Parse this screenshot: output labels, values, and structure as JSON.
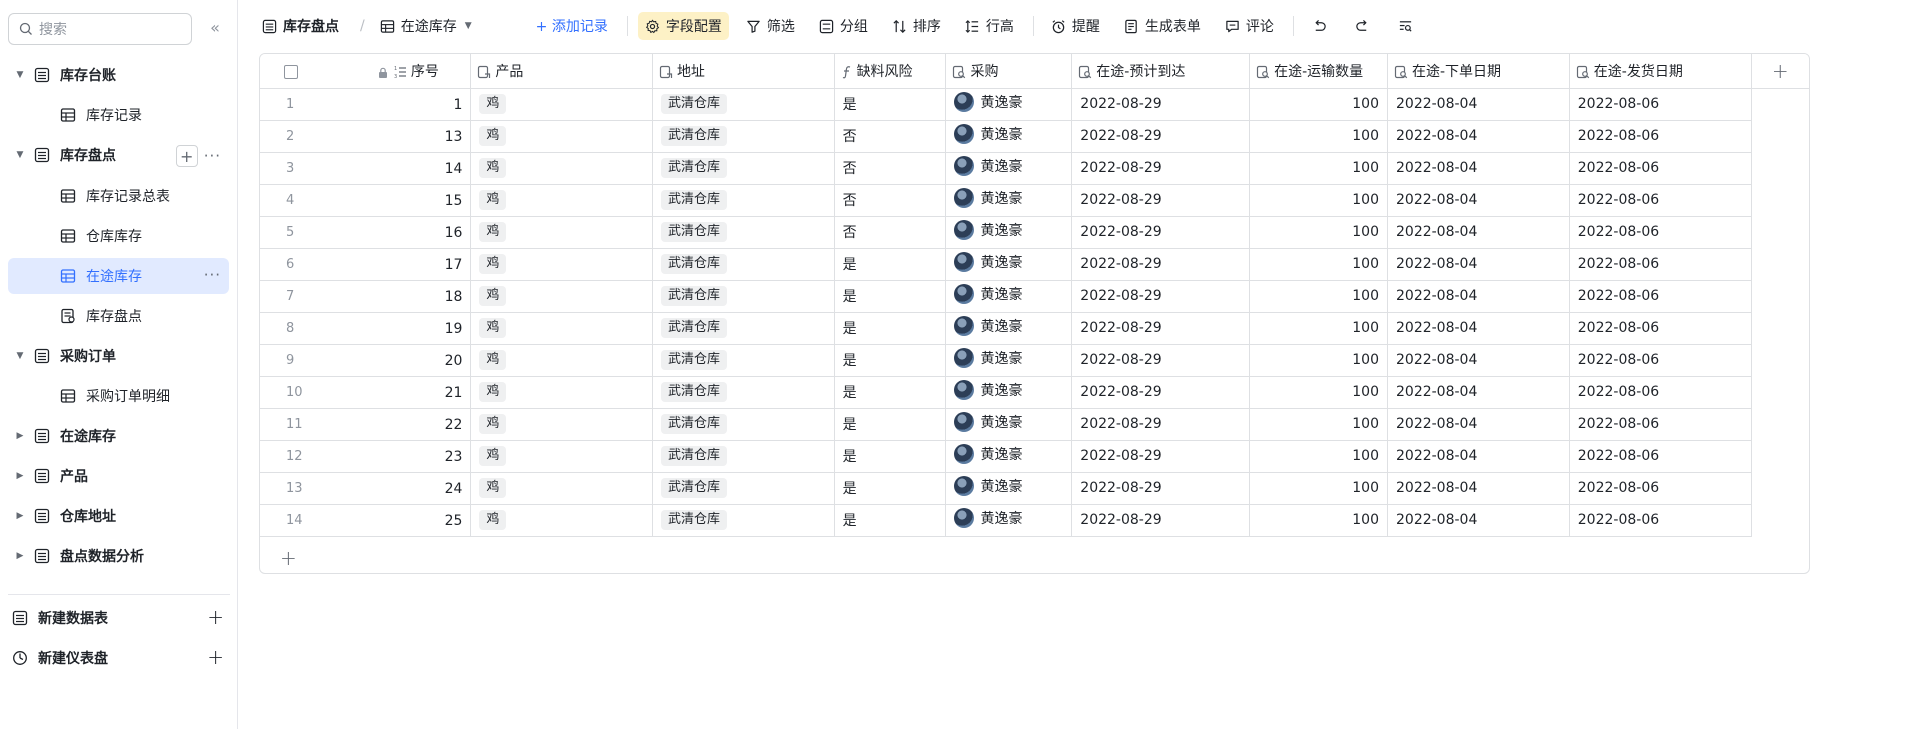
{
  "sidebar": {
    "search_placeholder": "搜索",
    "collapse_icon": "«",
    "items": [
      {
        "label": "库存台账",
        "level": "top",
        "icon": "table-icon",
        "expanded": true
      },
      {
        "label": "库存记录",
        "level": "child",
        "icon": "grid-icon"
      },
      {
        "label": "库存盘点",
        "level": "top",
        "icon": "table-icon",
        "expanded": true
      },
      {
        "label": "库存记录总表",
        "level": "child",
        "icon": "grid-icon"
      },
      {
        "label": "仓库库存",
        "level": "child",
        "icon": "grid-icon"
      },
      {
        "label": "在途库存",
        "level": "child",
        "icon": "grid-icon",
        "active": true
      },
      {
        "label": "库存盘点",
        "level": "child",
        "icon": "form-icon"
      },
      {
        "label": "采购订单",
        "level": "top",
        "icon": "table-icon",
        "expanded": true
      },
      {
        "label": "采购订单明细",
        "level": "child",
        "icon": "grid-icon"
      },
      {
        "label": "在途库存",
        "level": "top",
        "icon": "table-icon",
        "expanded": false
      },
      {
        "label": "产品",
        "level": "top",
        "icon": "table-icon",
        "expanded": false
      },
      {
        "label": "仓库地址",
        "level": "top",
        "icon": "table-icon",
        "expanded": false
      },
      {
        "label": "盘点数据分析",
        "level": "top",
        "icon": "table-icon",
        "expanded": false
      }
    ],
    "new_table": "新建数据表",
    "new_dashboard": "新建仪表盘"
  },
  "toolbar": {
    "table_title": "库存盘点",
    "separator": "/",
    "view_name": "在途库存",
    "add_record": "+ 添加记录",
    "field_config": "字段配置",
    "filter": "筛选",
    "group": "分组",
    "sort": "排序",
    "row_height": "行高",
    "reminder": "提醒",
    "generate_form": "生成表单",
    "comment": "评论"
  },
  "table": {
    "columns": [
      "序号",
      "产品",
      "地址",
      "缺料风险",
      "采购",
      "在途-预计到达",
      "在途-运输数量",
      "在途-下单日期",
      "在途-发货日期"
    ],
    "rows": [
      {
        "idx": "1",
        "seq": "1",
        "product": "鸡",
        "address": "武清仓库",
        "risk": "是",
        "buyer": "黄逸豪",
        "eta": "2022-08-29",
        "qty": "100",
        "order_date": "2022-08-04",
        "ship_date": "2022-08-06"
      },
      {
        "idx": "2",
        "seq": "13",
        "product": "鸡",
        "address": "武清仓库",
        "risk": "否",
        "buyer": "黄逸豪",
        "eta": "2022-08-29",
        "qty": "100",
        "order_date": "2022-08-04",
        "ship_date": "2022-08-06"
      },
      {
        "idx": "3",
        "seq": "14",
        "product": "鸡",
        "address": "武清仓库",
        "risk": "否",
        "buyer": "黄逸豪",
        "eta": "2022-08-29",
        "qty": "100",
        "order_date": "2022-08-04",
        "ship_date": "2022-08-06"
      },
      {
        "idx": "4",
        "seq": "15",
        "product": "鸡",
        "address": "武清仓库",
        "risk": "否",
        "buyer": "黄逸豪",
        "eta": "2022-08-29",
        "qty": "100",
        "order_date": "2022-08-04",
        "ship_date": "2022-08-06"
      },
      {
        "idx": "5",
        "seq": "16",
        "product": "鸡",
        "address": "武清仓库",
        "risk": "否",
        "buyer": "黄逸豪",
        "eta": "2022-08-29",
        "qty": "100",
        "order_date": "2022-08-04",
        "ship_date": "2022-08-06"
      },
      {
        "idx": "6",
        "seq": "17",
        "product": "鸡",
        "address": "武清仓库",
        "risk": "是",
        "buyer": "黄逸豪",
        "eta": "2022-08-29",
        "qty": "100",
        "order_date": "2022-08-04",
        "ship_date": "2022-08-06"
      },
      {
        "idx": "7",
        "seq": "18",
        "product": "鸡",
        "address": "武清仓库",
        "risk": "是",
        "buyer": "黄逸豪",
        "eta": "2022-08-29",
        "qty": "100",
        "order_date": "2022-08-04",
        "ship_date": "2022-08-06"
      },
      {
        "idx": "8",
        "seq": "19",
        "product": "鸡",
        "address": "武清仓库",
        "risk": "是",
        "buyer": "黄逸豪",
        "eta": "2022-08-29",
        "qty": "100",
        "order_date": "2022-08-04",
        "ship_date": "2022-08-06"
      },
      {
        "idx": "9",
        "seq": "20",
        "product": "鸡",
        "address": "武清仓库",
        "risk": "是",
        "buyer": "黄逸豪",
        "eta": "2022-08-29",
        "qty": "100",
        "order_date": "2022-08-04",
        "ship_date": "2022-08-06"
      },
      {
        "idx": "10",
        "seq": "21",
        "product": "鸡",
        "address": "武清仓库",
        "risk": "是",
        "buyer": "黄逸豪",
        "eta": "2022-08-29",
        "qty": "100",
        "order_date": "2022-08-04",
        "ship_date": "2022-08-06"
      },
      {
        "idx": "11",
        "seq": "22",
        "product": "鸡",
        "address": "武清仓库",
        "risk": "是",
        "buyer": "黄逸豪",
        "eta": "2022-08-29",
        "qty": "100",
        "order_date": "2022-08-04",
        "ship_date": "2022-08-06"
      },
      {
        "idx": "12",
        "seq": "23",
        "product": "鸡",
        "address": "武清仓库",
        "risk": "是",
        "buyer": "黄逸豪",
        "eta": "2022-08-29",
        "qty": "100",
        "order_date": "2022-08-04",
        "ship_date": "2022-08-06"
      },
      {
        "idx": "13",
        "seq": "24",
        "product": "鸡",
        "address": "武清仓库",
        "risk": "是",
        "buyer": "黄逸豪",
        "eta": "2022-08-29",
        "qty": "100",
        "order_date": "2022-08-04",
        "ship_date": "2022-08-06"
      },
      {
        "idx": "14",
        "seq": "25",
        "product": "鸡",
        "address": "武清仓库",
        "risk": "是",
        "buyer": "黄逸豪",
        "eta": "2022-08-29",
        "qty": "100",
        "order_date": "2022-08-04",
        "ship_date": "2022-08-06"
      }
    ],
    "add_row": "+",
    "add_column": "+"
  },
  "colors": {
    "accent": "#3370ff",
    "active_nav_bg": "#e1eaff",
    "field_config_bg": "#fdf1c6",
    "tag_bg": "#eff0f1",
    "border": "#dee0e3"
  }
}
